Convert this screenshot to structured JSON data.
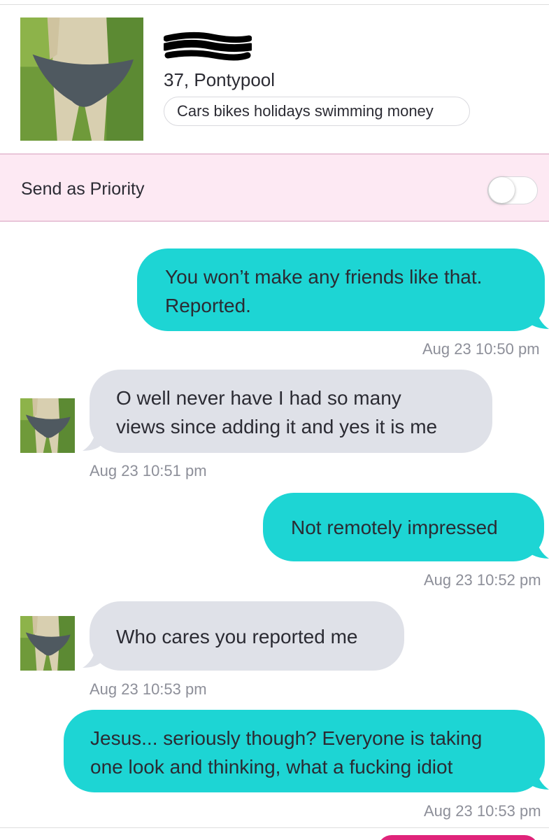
{
  "profile": {
    "age_location": "37, Pontypool",
    "interests": "Cars bikes holidays swimming money"
  },
  "priority": {
    "label": "Send as Priority",
    "enabled": false
  },
  "messages": [
    {
      "direction": "sent",
      "text": "You won’t make any friends like that.\nReported.",
      "time": "Aug 23 10:50 pm"
    },
    {
      "direction": "received",
      "text": "O well never have I had so many\nviews since adding it and yes it is me",
      "time": "Aug 23 10:51 pm"
    },
    {
      "direction": "sent",
      "text": "Not remotely impressed",
      "time": "Aug 23 10:52 pm"
    },
    {
      "direction": "received",
      "text": "Who cares you reported me",
      "time": "Aug 23 10:53 pm"
    },
    {
      "direction": "sent",
      "text": "Jesus... seriously though? Everyone is taking\none look and thinking, what a fucking idiot",
      "time": "Aug 23 10:53 pm"
    }
  ],
  "colors": {
    "sent_bubble": "#1dd5d4",
    "received_bubble": "#dfe1e8",
    "priority_background": "#fde9f3",
    "accent": "#e0247a"
  }
}
